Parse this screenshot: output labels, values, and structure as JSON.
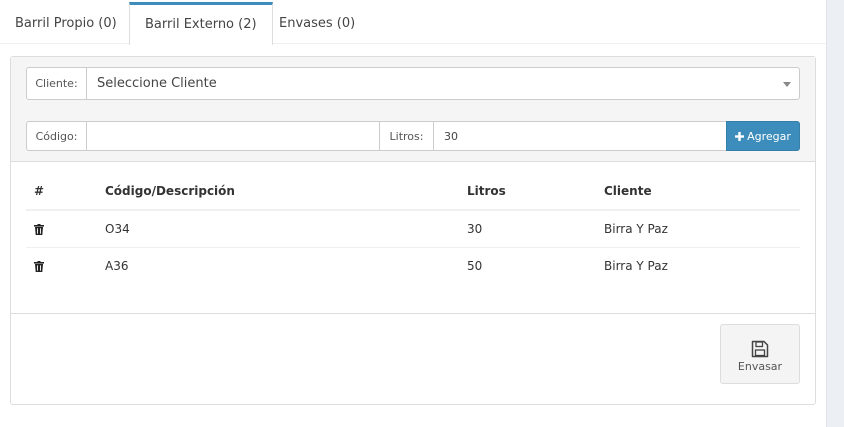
{
  "tabs": [
    {
      "label": "Barril Propio (0)",
      "active": false
    },
    {
      "label": "Barril Externo (2)",
      "active": true
    },
    {
      "label": "Envases (0)",
      "active": false
    }
  ],
  "form": {
    "cliente_label": "Cliente:",
    "cliente_value": "Seleccione Cliente",
    "codigo_label": "Código:",
    "codigo_value": "",
    "litros_label": "Litros:",
    "litros_value": "30",
    "add_button": "Agregar"
  },
  "table": {
    "headers": [
      "#",
      "Código/Descripción",
      "Litros",
      "Cliente"
    ],
    "rows": [
      {
        "codigo": "O34",
        "litros": "30",
        "cliente": "Birra Y Paz"
      },
      {
        "codigo": "A36",
        "litros": "50",
        "cliente": "Birra Y Paz"
      }
    ]
  },
  "footer": {
    "envasar_button": "Envasar"
  },
  "colors": {
    "accent": "#3c8dbc",
    "panel_bg": "#f5f5f5"
  },
  "icons": {
    "row_action": "trash-icon",
    "add": "plus-icon",
    "envasar": "save-icon"
  }
}
